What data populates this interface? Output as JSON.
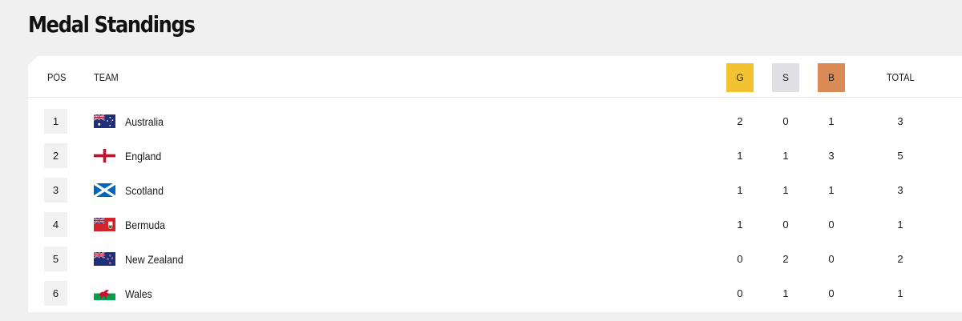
{
  "page": {
    "title": "Medal Standings"
  },
  "table": {
    "headers": {
      "pos": "POS",
      "team": "TEAM",
      "gold": "G",
      "silver": "S",
      "bronze": "B",
      "total": "TOTAL"
    },
    "colors": {
      "gold": "#f2c230",
      "silver": "#e0dfe4",
      "bronze": "#d98a55"
    },
    "rows": [
      {
        "pos": "1",
        "team": "Australia",
        "flag": "australia-flag",
        "gold": "2",
        "silver": "0",
        "bronze": "1",
        "total": "3"
      },
      {
        "pos": "2",
        "team": "England",
        "flag": "england-flag",
        "gold": "1",
        "silver": "1",
        "bronze": "3",
        "total": "5"
      },
      {
        "pos": "3",
        "team": "Scotland",
        "flag": "scotland-flag",
        "gold": "1",
        "silver": "1",
        "bronze": "1",
        "total": "3"
      },
      {
        "pos": "4",
        "team": "Bermuda",
        "flag": "bermuda-flag",
        "gold": "1",
        "silver": "0",
        "bronze": "0",
        "total": "1"
      },
      {
        "pos": "5",
        "team": "New Zealand",
        "flag": "new-zealand-flag",
        "gold": "0",
        "silver": "2",
        "bronze": "0",
        "total": "2"
      },
      {
        "pos": "6",
        "team": "Wales",
        "flag": "wales-flag",
        "gold": "0",
        "silver": "1",
        "bronze": "0",
        "total": "1"
      }
    ]
  }
}
